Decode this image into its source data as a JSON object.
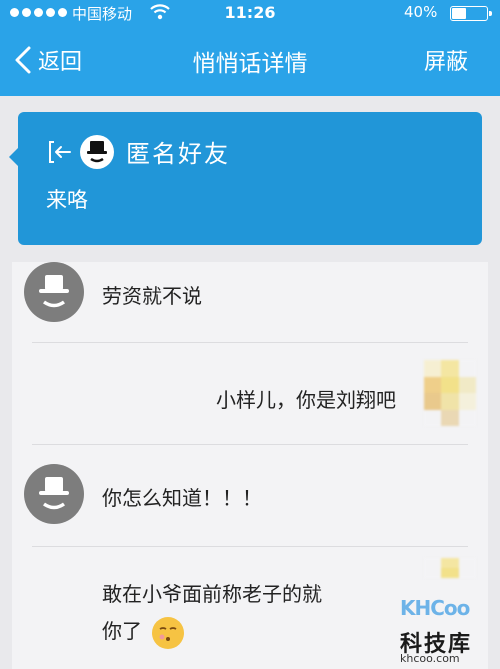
{
  "status_bar": {
    "carrier": "中国移动",
    "time": "11:26",
    "battery": "40%",
    "battery_level": 0.4
  },
  "nav": {
    "back_label": "返回",
    "title": "悄悄话详情",
    "block_label": "屏蔽"
  },
  "whisper": {
    "sender_name": "匿名好友",
    "message": "来咯"
  },
  "chat": [
    {
      "side": "left",
      "avatar": "anonymous-avatar",
      "text": "劳资就不说"
    },
    {
      "side": "right",
      "avatar": "pixelated-avatar",
      "text": "小样儿，你是刘翔吧"
    },
    {
      "side": "left",
      "avatar": "anonymous-avatar",
      "text": "你怎么知道！！！"
    },
    {
      "side": "right",
      "avatar": "pixelated-avatar",
      "text_line1": "敢在小爷面前称老子的就",
      "text_line2": "你了",
      "emoji": "smirk-kiss-emoji"
    }
  ],
  "watermark": {
    "logo": "KHCoo",
    "name": "科技库",
    "url": "khcoo.com"
  },
  "colors": {
    "nav_bar": "#2aa3e8",
    "whisper_card": "#2196d8",
    "anon_avatar": "#7d7d7d"
  }
}
